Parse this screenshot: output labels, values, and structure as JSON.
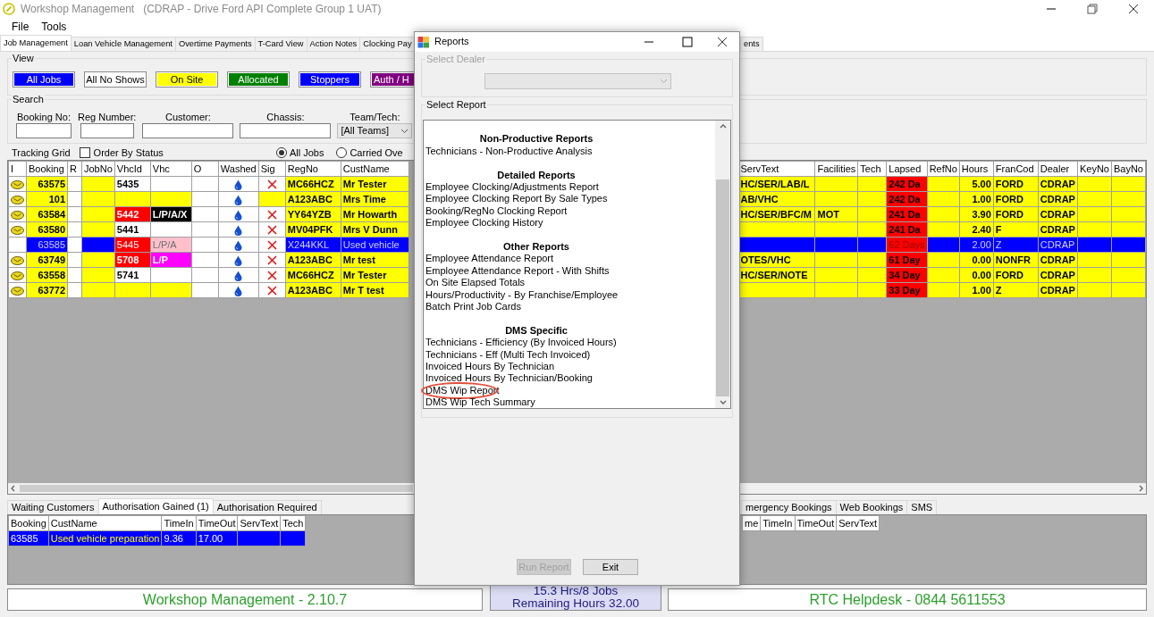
{
  "window": {
    "title": "Workshop Management   (CDRAP - Drive Ford API Complete Group 1 UAT)"
  },
  "menu": [
    "File",
    "Tools"
  ],
  "tabs": [
    {
      "label": "Job Management",
      "selected": true
    },
    {
      "label": "Loan Vehicle Management",
      "selected": false
    },
    {
      "label": "Overtime Payments",
      "selected": false
    },
    {
      "label": "T-Card View",
      "selected": false
    },
    {
      "label": "Action Notes",
      "selected": false
    },
    {
      "label": "Clocking Pay",
      "selected": false
    }
  ],
  "tabs_right": [
    {
      "label": "ents",
      "selected": false
    }
  ],
  "view": {
    "title": "View",
    "buttons": [
      {
        "label": "All Jobs",
        "color": "#0000ff"
      },
      {
        "label": "All No Shows",
        "color": "#ffffff"
      },
      {
        "label": "On Site",
        "color": "#ffff00"
      },
      {
        "label": "Allocated",
        "color": "#008000"
      },
      {
        "label": "Stoppers",
        "color": "#0000ff"
      },
      {
        "label": "Auth / H",
        "color": "#800080"
      }
    ]
  },
  "search": {
    "title": "Search",
    "fields": [
      {
        "label": "Booking No:",
        "kind": "text"
      },
      {
        "label": "Reg Number:",
        "kind": "text"
      },
      {
        "label": "Customer:",
        "kind": "text"
      },
      {
        "label": "Chassis:",
        "kind": "text"
      },
      {
        "label": "Team/Tech:",
        "kind": "select",
        "value": "[All Teams]"
      }
    ]
  },
  "tracking": {
    "title": "Tracking Grid",
    "order_by_status": {
      "label": "Order By Status",
      "checked": false
    },
    "filters": [
      {
        "label": "All Jobs",
        "selected": true
      },
      {
        "label": "Carried Ove",
        "selected": false
      }
    ]
  },
  "grid": {
    "columns": [
      "I",
      "Booking",
      "R",
      "JobNo",
      "VhcId",
      "Vhc",
      "O",
      "Washed",
      "Sig",
      "RegNo",
      "CustName"
    ],
    "columns_right": [
      "ServText",
      "Facilities",
      "Tech",
      "Lapsed",
      "RefNo",
      "Hours",
      "FranCod",
      "Dealer",
      "KeyNo",
      "BayNo"
    ],
    "rows": [
      {
        "selected": false,
        "envelope": true,
        "booking": "63575",
        "vhcid": {
          "text": "5435",
          "color": "#ffffff"
        },
        "vhc": {
          "color": "#ffffff"
        },
        "sig_cross": true,
        "reg_no": "MC66HCZ",
        "cust_name": "Mr Tester",
        "serv_text": "HC/SER/LAB/L",
        "lapsed": "242 Da",
        "hours": "5.00",
        "fran_code": "FORD",
        "dealer": "CDRAP"
      },
      {
        "selected": false,
        "envelope": true,
        "booking": "101",
        "vhcid": {
          "color": "#ffff00"
        },
        "vhc": {
          "color": "#ffff00"
        },
        "sig_cross": false,
        "reg_no": "A123ABC",
        "cust_name": "Mrs Time",
        "serv_text": "AB/VHC",
        "lapsed": "242 Da",
        "hours": "1.00",
        "fran_code": "FORD",
        "dealer": "CDRAP"
      },
      {
        "selected": false,
        "envelope": true,
        "booking": "63584",
        "vhcid": {
          "text": "5442",
          "color": "#ff0000"
        },
        "vhc": {
          "text": "L/P/A/X",
          "color": "#000000"
        },
        "sig_cross": true,
        "reg_no": "YY64YZB",
        "cust_name": "Mr Howarth",
        "serv_text": "HC/SER/BFC/M",
        "facilities": "MOT",
        "lapsed": "241 Da",
        "hours": "3.90",
        "fran_code": "FORD",
        "dealer": "CDRAP"
      },
      {
        "selected": false,
        "envelope": true,
        "booking": "63580",
        "vhcid": {
          "text": "5441",
          "color": "#ffffff"
        },
        "vhc": {
          "color": "#ffffff"
        },
        "sig_cross": true,
        "reg_no": "MV04PFK",
        "cust_name": "Mrs V Dunn",
        "lapsed": "241 Da",
        "hours": "2.40",
        "fran_code": "F",
        "dealer": "CDRAP"
      },
      {
        "selected": true,
        "envelope": false,
        "booking": "63585",
        "vhcid": {
          "text": "5445",
          "color": "#ff0000"
        },
        "vhc": {
          "text": "L/P/A",
          "color": "#ffc0cb"
        },
        "sig_cross": true,
        "reg_no": "X244KKL",
        "cust_name": "Used vehicle",
        "lapsed": "62 Days",
        "hours": "2.00",
        "fran_code": "Z",
        "dealer": "CDRAP"
      },
      {
        "selected": false,
        "envelope": true,
        "booking": "63749",
        "vhcid": {
          "text": "5708",
          "color": "#ff0000"
        },
        "vhc": {
          "text": "L/P",
          "color": "#ff00ff"
        },
        "sig_cross": true,
        "reg_no": "A123ABC",
        "cust_name": "Mr test",
        "serv_text": "OTES/VHC",
        "lapsed": "61 Day",
        "hours": "0.00",
        "fran_code": "NONFR",
        "dealer": "CDRAP"
      },
      {
        "selected": false,
        "envelope": true,
        "booking": "63558",
        "vhcid": {
          "text": "5741",
          "color": "#ffffff"
        },
        "vhc": {
          "color": "#ffffff"
        },
        "sig_cross": true,
        "reg_no": "MC66HCZ",
        "cust_name": "Mr Tester",
        "serv_text": "HC/SER/NOTE",
        "lapsed": "34 Day",
        "hours": "0.00",
        "fran_code": "FORD",
        "dealer": "CDRAP"
      },
      {
        "selected": false,
        "envelope": true,
        "booking": "63772",
        "vhcid": {
          "color": "#ffff00"
        },
        "vhc": {
          "color": "#ffff00"
        },
        "sig_cross": true,
        "reg_no": "A123ABC",
        "cust_name": "Mr T test",
        "lapsed": "33 Day",
        "hours": "1.00",
        "fran_code": "Z",
        "dealer": "CDRAP"
      }
    ]
  },
  "bottom_left": {
    "tabs": [
      {
        "label": "Waiting Customers",
        "selected": false
      },
      {
        "label": "Authorisation Gained (1)",
        "selected": true
      },
      {
        "label": "Authorisation Required",
        "selected": false
      }
    ],
    "columns": [
      "Booking",
      "CustName",
      "TimeIn",
      "TimeOut",
      "ServText",
      "Tech"
    ],
    "rows": [
      {
        "selected": true,
        "booking": "63585",
        "cust_name": "Used vehicle preparation",
        "time_in": "9.36",
        "time_out": "17.00"
      }
    ]
  },
  "bottom_right": {
    "tabs": [
      {
        "label": "mergency Bookings",
        "selected": false
      },
      {
        "label": "Web Bookings",
        "selected": false
      },
      {
        "label": "SMS",
        "selected": false
      }
    ],
    "columns": [
      "me",
      "TimeIn",
      "TimeOut",
      "ServText"
    ]
  },
  "status_bar": {
    "version": "Workshop Management - 2.10.7",
    "hours": "15.3 Hrs/8 Jobs",
    "remaining": "Remaining Hours 32.00",
    "helpdesk": "RTC Helpdesk - 0844 5611553"
  },
  "dialog": {
    "title": "Reports",
    "dealer": {
      "label": "Select Dealer",
      "disabled": true
    },
    "report_title": "Select Report",
    "sections": [
      {
        "heading": "Non-Productive Reports",
        "items": [
          {
            "label": "Technicians - Non-Productive Analysis",
            "highlighted": false
          }
        ]
      },
      {
        "heading": "Detailed Reports",
        "items": [
          {
            "label": "Employee Clocking/Adjustments Report",
            "highlighted": false
          },
          {
            "label": "Employee Clocking Report By Sale Types",
            "highlighted": false
          },
          {
            "label": "Booking/RegNo Clocking Report",
            "highlighted": false
          },
          {
            "label": "Employee Clocking History",
            "highlighted": false
          }
        ]
      },
      {
        "heading": "Other Reports",
        "items": [
          {
            "label": "Employee Attendance Report",
            "highlighted": false
          },
          {
            "label": "Employee Attendance Report - With Shifts",
            "highlighted": false
          },
          {
            "label": "On Site Elapsed Totals",
            "highlighted": false
          },
          {
            "label": "Hours/Productivity - By Franchise/Employee",
            "highlighted": false
          },
          {
            "label": "Batch Print Job Cards",
            "highlighted": false
          }
        ]
      },
      {
        "heading": "DMS Specific",
        "items": [
          {
            "label": "Technicians - Efficiency (By Invoiced Hours)",
            "highlighted": false
          },
          {
            "label": "Technicians - Eff (Multi Tech Invoiced)",
            "highlighted": false
          },
          {
            "label": "Invoiced Hours By Technician",
            "highlighted": false
          },
          {
            "label": "Invoiced Hours By Technician/Booking",
            "highlighted": false
          },
          {
            "label": "DMS Wip Report",
            "highlighted": true
          },
          {
            "label": "DMS Wip Tech Summary",
            "highlighted": false
          }
        ]
      }
    ],
    "buttons": [
      {
        "label": "Run Report",
        "disabled": true
      },
      {
        "label": "Exit",
        "disabled": false
      }
    ]
  }
}
